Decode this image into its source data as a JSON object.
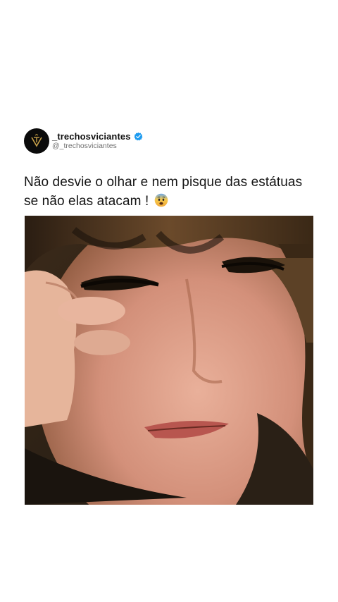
{
  "post": {
    "display_name": "_trechosviciantes",
    "handle": "@_trechosviciantes",
    "text": "Não desvie o olhar e nem pisque das estátuas se não elas atacam !",
    "emoji": "fearful-face-emoji"
  },
  "icons": {
    "avatar_logo": "monogram-logo-icon",
    "verified": "verified-badge-icon"
  },
  "colors": {
    "verified_blue": "#1d9bf0",
    "avatar_bg": "#0b0b0b",
    "logo_gold": "#c9a24a"
  }
}
